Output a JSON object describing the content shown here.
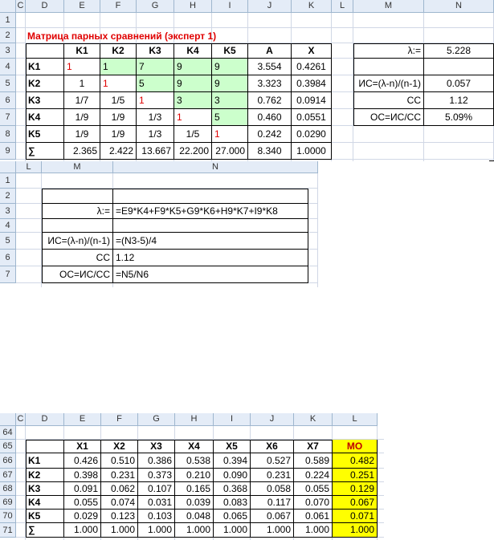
{
  "sheet1": {
    "col_headers": [
      "C",
      "D",
      "E",
      "F",
      "G",
      "H",
      "I",
      "J",
      "K",
      "L",
      "M",
      "N"
    ],
    "row_headers": [
      "1",
      "2",
      "3",
      "4",
      "5",
      "6",
      "7",
      "8",
      "9"
    ],
    "title": "Матрица парных сравнений (эксперт 1)",
    "matrix_header": [
      "",
      "K1",
      "K2",
      "K3",
      "K4",
      "K5",
      "A",
      "X"
    ],
    "matrix_rows": [
      [
        "K1",
        "1",
        "1",
        "7",
        "9",
        "9",
        "3.554",
        "0.4261"
      ],
      [
        "K2",
        "1",
        "1",
        "5",
        "9",
        "9",
        "3.323",
        "0.3984"
      ],
      [
        "K3",
        "1/7",
        "1/5",
        "1",
        "3",
        "3",
        "0.762",
        "0.0914"
      ],
      [
        "K4",
        "1/9",
        "1/9",
        "1/3",
        "1",
        "5",
        "0.460",
        "0.0551"
      ],
      [
        "K5",
        "1/9",
        "1/9",
        "1/3",
        "1/5",
        "1",
        "0.242",
        "0.0290"
      ],
      [
        "∑",
        "2.365",
        "2.422",
        "13.667",
        "22.200",
        "27.000",
        "8.340",
        "1.0000"
      ]
    ],
    "stats": [
      {
        "label": "λ:=",
        "value": "5.228"
      },
      {
        "label": "",
        "value": ""
      },
      {
        "label": "ИС=(λ-n)/(n-1)",
        "value": "0.057"
      },
      {
        "label": "СС",
        "value": "1.12"
      },
      {
        "label": "ОС=ИС/СС",
        "value": "5.09%"
      }
    ]
  },
  "sheet2": {
    "col_headers": [
      "L",
      "M",
      "N"
    ],
    "row_headers": [
      "1",
      "2",
      "3",
      "4",
      "5",
      "6",
      "7"
    ],
    "formulas": [
      {
        "label": "",
        "value": ""
      },
      {
        "label": "λ:=",
        "value": "=E9*K4+F9*K5+G9*K6+H9*K7+I9*K8"
      },
      {
        "label": "",
        "value": ""
      },
      {
        "label": "ИС=(λ-n)/(n-1)",
        "value": "=(N3-5)/4"
      },
      {
        "label": "СС",
        "value": "1.12"
      },
      {
        "label": "ОС=ИС/СС",
        "value": "=N5/N6"
      }
    ]
  },
  "sheet3": {
    "col_headers": [
      "C",
      "D",
      "E",
      "F",
      "G",
      "H",
      "I",
      "J",
      "K",
      "L"
    ],
    "row_headers": [
      "64",
      "65",
      "66",
      "67",
      "68",
      "69",
      "70",
      "71"
    ],
    "header": [
      "",
      "X1",
      "X2",
      "X3",
      "X4",
      "X5",
      "X6",
      "X7",
      "MO"
    ],
    "rows": [
      [
        "K1",
        "0.426",
        "0.510",
        "0.386",
        "0.538",
        "0.394",
        "0.527",
        "0.589",
        "0.482"
      ],
      [
        "K2",
        "0.398",
        "0.231",
        "0.373",
        "0.210",
        "0.090",
        "0.231",
        "0.224",
        "0.251"
      ],
      [
        "K3",
        "0.091",
        "0.062",
        "0.107",
        "0.165",
        "0.368",
        "0.058",
        "0.055",
        "0.129"
      ],
      [
        "K4",
        "0.055",
        "0.074",
        "0.031",
        "0.039",
        "0.083",
        "0.117",
        "0.070",
        "0.067"
      ],
      [
        "K5",
        "0.029",
        "0.123",
        "0.103",
        "0.048",
        "0.065",
        "0.067",
        "0.061",
        "0.071"
      ],
      [
        "∑",
        "1.000",
        "1.000",
        "1.000",
        "1.000",
        "1.000",
        "1.000",
        "1.000",
        "1.000"
      ]
    ]
  },
  "colors": {
    "title_red": "#e00000",
    "green_fill": "#ccffcc",
    "yellow_fill": "#ffff00",
    "header_fill": "#e4ecf7"
  }
}
